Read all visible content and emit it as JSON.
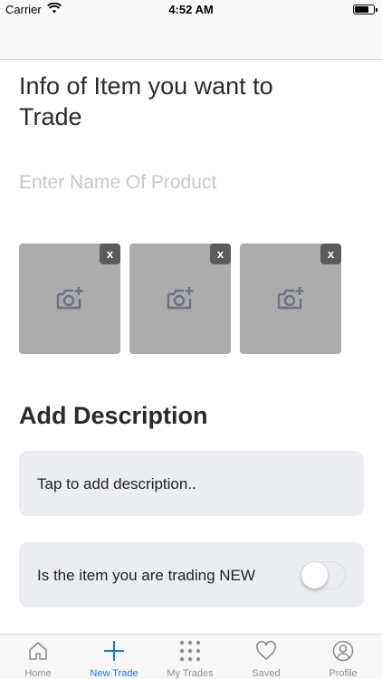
{
  "status_bar": {
    "carrier": "Carrier",
    "time": "4:52 AM"
  },
  "header": {
    "title": "Info of Item you want to Trade"
  },
  "product": {
    "placeholder": "Enter Name Of Product",
    "value": ""
  },
  "photos": {
    "remove_label": "x",
    "icon": "camera-add-icon",
    "count": 3
  },
  "description": {
    "section_title": "Add Description",
    "prompt": "Tap to add description.."
  },
  "is_new": {
    "label": "Is the item you are trading NEW",
    "checked": false
  },
  "tab_bar": {
    "tabs": [
      {
        "label": "Home",
        "icon": "home-icon"
      },
      {
        "label": "New Trade",
        "icon": "plus-icon",
        "active": true
      },
      {
        "label": "My Trades",
        "icon": "grid-icon"
      },
      {
        "label": "Saved",
        "icon": "heart-icon"
      },
      {
        "label": "Profile",
        "icon": "profile-icon"
      }
    ]
  },
  "colors": {
    "accent": "#1777e8",
    "card_bg": "#ebedf0",
    "photo_bg": "#acacac",
    "remove_bg": "#5c5c5c"
  }
}
